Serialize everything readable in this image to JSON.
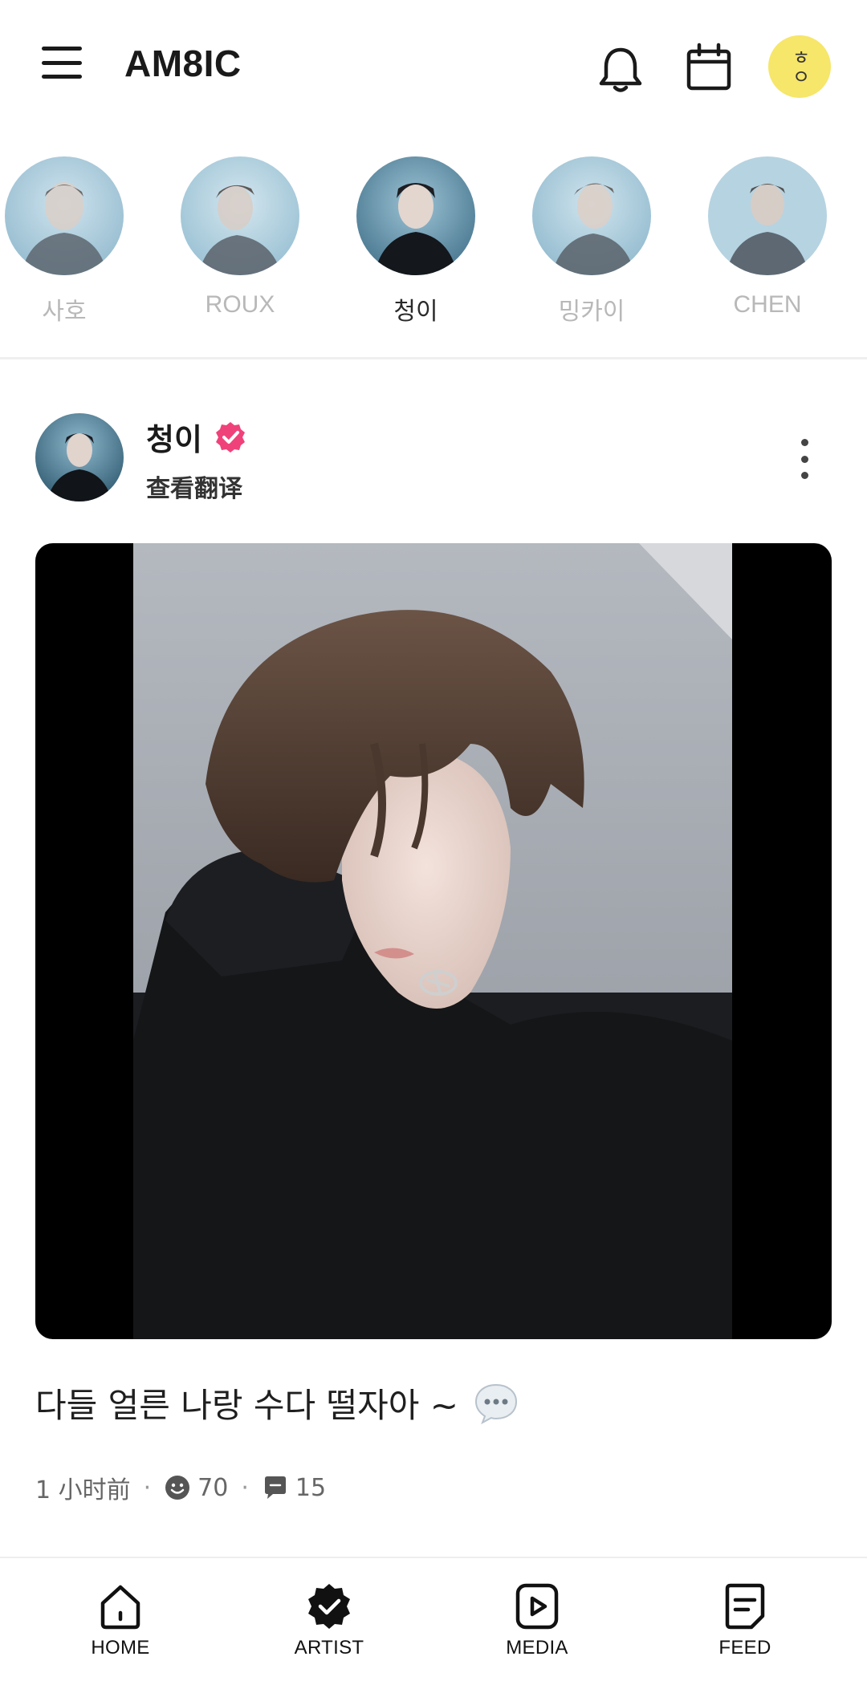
{
  "header": {
    "app_title": "AM8IC",
    "menu_icon": "hamburger-menu-icon",
    "notification_icon": "bell-icon",
    "calendar_icon": "calendar-icon",
    "profile_glyph": "ㅎㅇ"
  },
  "artists": [
    {
      "name": "사호",
      "active": false
    },
    {
      "name": "ROUX",
      "active": false
    },
    {
      "name": "청이",
      "active": true
    },
    {
      "name": "밍카이",
      "active": false
    },
    {
      "name": "CHEN",
      "active": false
    }
  ],
  "post": {
    "author": "청이",
    "verified_icon": "verified-badge-icon",
    "translate_label": "查看翻译",
    "text": "다들 얼른 나랑 수다 떨자아 ~",
    "time": "1 小时前",
    "reactions": "70",
    "comments": "15"
  },
  "bottom_nav": {
    "items": [
      {
        "label": "HOME",
        "icon": "home-icon"
      },
      {
        "label": "ARTIST",
        "icon": "artist-badge-icon"
      },
      {
        "label": "MEDIA",
        "icon": "play-icon"
      },
      {
        "label": "FEED",
        "icon": "feed-icon"
      }
    ]
  },
  "colors": {
    "profile_bg": "#f6e66a",
    "verified": "#f0427a",
    "inactive_text": "#b8b8b8"
  }
}
